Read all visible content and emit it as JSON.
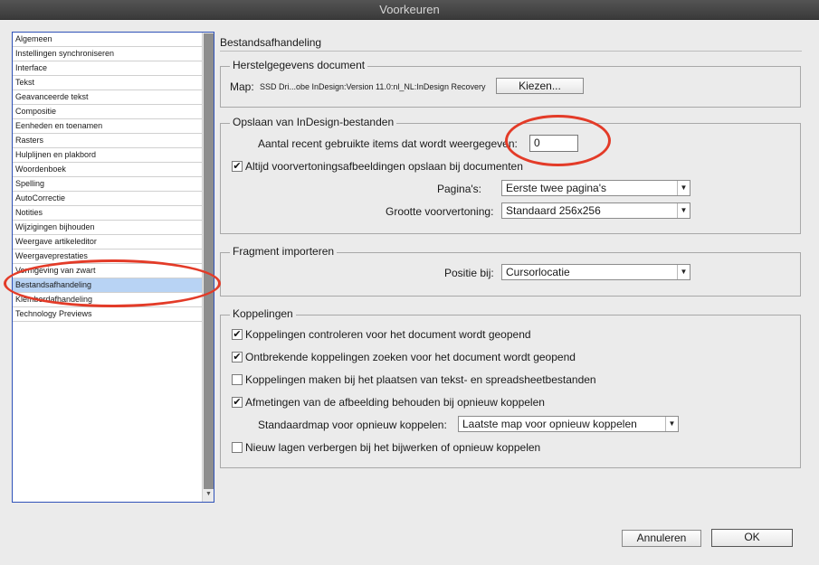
{
  "window": {
    "title": "Voorkeuren"
  },
  "sidebar": {
    "items": [
      {
        "label": "Algemeen"
      },
      {
        "label": "Instellingen synchroniseren"
      },
      {
        "label": "Interface"
      },
      {
        "label": "Tekst"
      },
      {
        "label": "Geavanceerde tekst"
      },
      {
        "label": "Compositie"
      },
      {
        "label": "Eenheden en toenamen"
      },
      {
        "label": "Rasters"
      },
      {
        "label": "Hulplijnen en plakbord"
      },
      {
        "label": "Woordenboek"
      },
      {
        "label": "Spelling"
      },
      {
        "label": "AutoCorrectie"
      },
      {
        "label": "Notities"
      },
      {
        "label": "Wijzigingen bijhouden"
      },
      {
        "label": "Weergave artikeleditor"
      },
      {
        "label": "Weergaveprestaties"
      },
      {
        "label": "Vormgeving van zwart"
      },
      {
        "label": "Bestandsafhandeling",
        "selected": true
      },
      {
        "label": "Klembordafhandeling"
      },
      {
        "label": "Technology Previews"
      }
    ]
  },
  "pane": {
    "title": "Bestandsafhandeling"
  },
  "recovery": {
    "title": "Herstelgegevens document",
    "map_label": "Map:",
    "path": "SSD Dri...obe InDesign:Version 11.0:nl_NL:InDesign Recovery",
    "choose_button": "Kiezen..."
  },
  "saving": {
    "title": "Opslaan van InDesign-bestanden",
    "recent_label": "Aantal recent gebruikte items dat wordt weergegeven:",
    "recent_value": "0",
    "always_preview": {
      "label": "Altijd voorvertoningsafbeeldingen opslaan bij documenten",
      "checked": true
    },
    "pages_label": "Pagina's:",
    "pages_value": "Eerste twee pagina's",
    "preview_size_label": "Grootte voorvertoning:",
    "preview_size_value": "Standaard 256x256"
  },
  "fragment": {
    "title": "Fragment importeren",
    "position_label": "Positie bij:",
    "position_value": "Cursorlocatie"
  },
  "links": {
    "title": "Koppelingen",
    "check_links": {
      "label": "Koppelingen controleren voor het document wordt geopend",
      "checked": true
    },
    "find_missing": {
      "label": "Ontbrekende koppelingen zoeken voor het document wordt geopend",
      "checked": true
    },
    "create_links": {
      "label": "Koppelingen maken bij het plaatsen van tekst- en spreadsheetbestanden",
      "checked": false
    },
    "keep_dimensions": {
      "label": "Afmetingen van de afbeelding behouden bij opnieuw koppelen",
      "checked": true
    },
    "default_folder_label": "Standaardmap voor opnieuw koppelen:",
    "default_folder_value": "Laatste map voor opnieuw koppelen",
    "hide_layers": {
      "label": "Nieuw lagen verbergen bij het bijwerken of opnieuw koppelen",
      "checked": false
    }
  },
  "footer": {
    "cancel": "Annuleren",
    "ok": "OK"
  },
  "glyphs": {
    "check": "✔",
    "arrow_down": "▼"
  },
  "colors": {
    "annotation": "#e33b28",
    "selection": "#b8d3f4",
    "list_border": "#2f52b8"
  }
}
